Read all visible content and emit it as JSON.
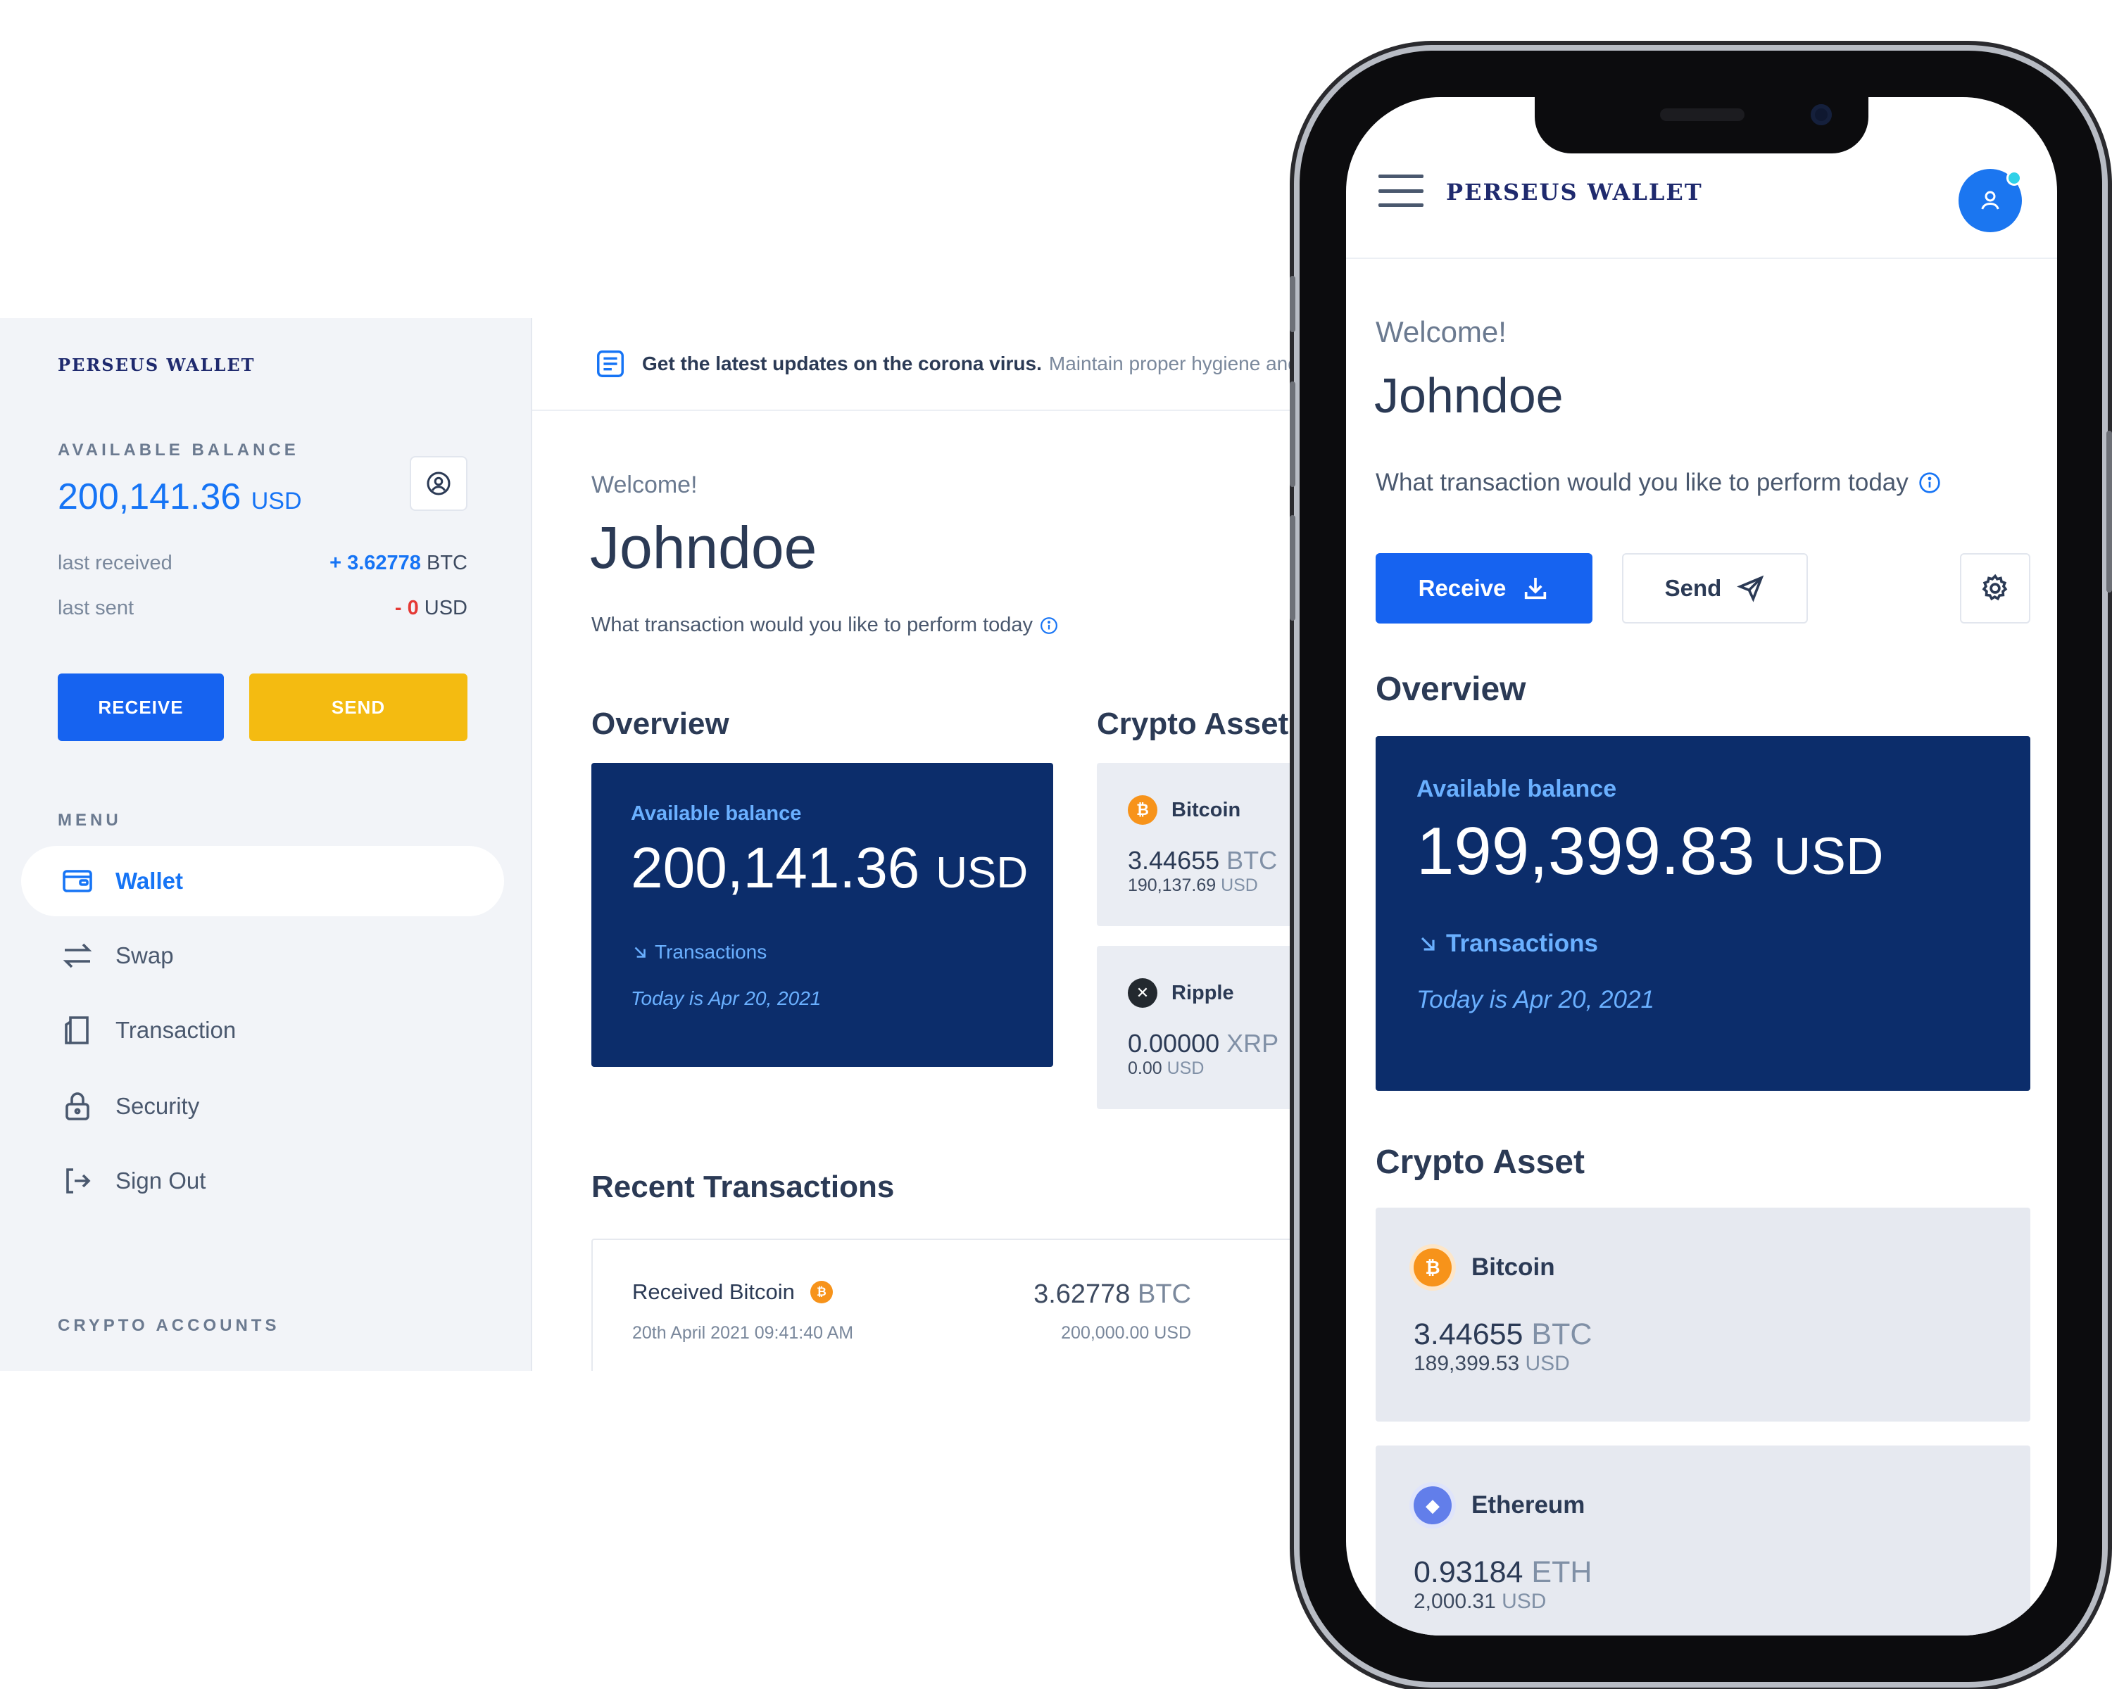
{
  "desktop": {
    "sidebar": {
      "brand": "PERSEUS WALLET",
      "available_balance_label": "AVAILABLE BALANCE",
      "available_balance_value": "200,141.36",
      "available_balance_currency": "USD",
      "last_received_label": "last received",
      "last_received_value": "+ 3.62778",
      "last_received_unit": "BTC",
      "last_sent_label": "last sent",
      "last_sent_value": "- 0",
      "last_sent_unit": "USD",
      "receive_label": "RECEIVE",
      "send_label": "SEND",
      "menu_label": "MENU",
      "menu_items": [
        {
          "label": "Wallet",
          "icon": "wallet-icon",
          "active": true
        },
        {
          "label": "Swap",
          "icon": "swap-icon"
        },
        {
          "label": "Transaction",
          "icon": "transaction-icon"
        },
        {
          "label": "Security",
          "icon": "lock-icon"
        },
        {
          "label": "Sign Out",
          "icon": "sign-out-icon"
        }
      ],
      "crypto_accounts_label": "CRYPTO ACCOUNTS"
    },
    "banner": {
      "strong": "Get the latest updates on the corona virus.",
      "light": "Maintain proper hygiene and"
    },
    "welcome": "Welcome!",
    "username": "Johndoe",
    "subline": "What transaction would you like to perform today",
    "overview_title": "Overview",
    "overview": {
      "label": "Available balance",
      "value": "200,141.36",
      "currency": "USD",
      "link": "Transactions",
      "date": "Today is Apr 20, 2021"
    },
    "crypto_asset_title": "Crypto Asset",
    "assets": [
      {
        "name": "Bitcoin",
        "amount": "3.44655",
        "unit": "BTC",
        "usd": "190,137.69",
        "usd_unit": "USD"
      },
      {
        "name": "Ripple",
        "amount": "0.00000",
        "unit": "XRP",
        "usd": "0.00",
        "usd_unit": "USD"
      }
    ],
    "recent_title": "Recent Transactions",
    "transaction": {
      "title": "Received Bitcoin",
      "time": "20th April 2021 09:41:40 AM",
      "amount": "3.62778",
      "unit": "BTC",
      "usd": "200,000.00 USD"
    }
  },
  "mobile": {
    "brand": "PERSEUS WALLET",
    "welcome": "Welcome!",
    "username": "Johndoe",
    "subline": "What transaction would you like to perform today",
    "receive_label": "Receive",
    "send_label": "Send",
    "overview_title": "Overview",
    "overview": {
      "label": "Available balance",
      "value": "199,399.83",
      "currency": "USD",
      "link": "Transactions",
      "date": "Today is Apr 20, 2021"
    },
    "crypto_asset_title": "Crypto Asset",
    "assets": [
      {
        "name": "Bitcoin",
        "amount": "3.44655",
        "unit": "BTC",
        "usd": "189,399.53",
        "usd_unit": "USD"
      },
      {
        "name": "Ethereum",
        "amount": "0.93184",
        "unit": "ETH",
        "usd": "2,000.31",
        "usd_unit": "USD"
      }
    ]
  },
  "colors": {
    "primary": "#1663f0",
    "accent_yellow": "#f4bb11",
    "navy_card": "#0c2d6b",
    "bitcoin": "#f7931a",
    "ethereum": "#627eea"
  }
}
